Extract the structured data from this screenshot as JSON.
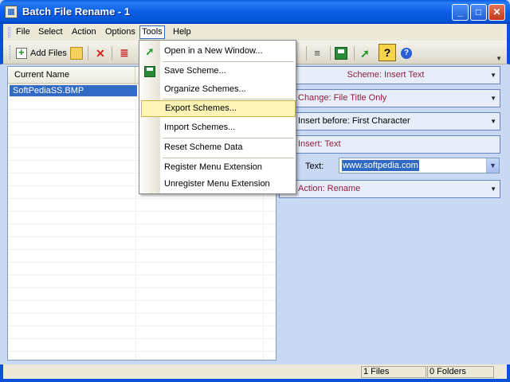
{
  "window": {
    "title": "Batch File Rename - 1",
    "controls": {
      "minimize": "_",
      "maximize": "□",
      "close": "✕"
    }
  },
  "menubar": {
    "items": [
      {
        "label": "File",
        "active": false
      },
      {
        "label": "Select",
        "active": false
      },
      {
        "label": "Action",
        "active": false
      },
      {
        "label": "Options",
        "active": false
      },
      {
        "label": "Tools",
        "active": true
      },
      {
        "label": "Help",
        "active": false
      }
    ]
  },
  "toolbar": {
    "add_files_label": "Add Files",
    "icons": [
      "add-files-icon",
      "add-folder-icon",
      "delete-icon",
      "red-list-icon",
      "align-icon",
      "save-icon",
      "up-icon",
      "help-icon",
      "info-icon"
    ]
  },
  "filelist": {
    "columns": [
      "Current Name"
    ],
    "rows": [
      {
        "name": "SoftPediaSS.BMP",
        "selected": true
      }
    ]
  },
  "tools_menu": {
    "items": [
      {
        "label": "Open in a New Window...",
        "icon": "open-window-icon",
        "highlighted": false
      },
      {
        "label": "Save Scheme...",
        "icon": "save-icon",
        "highlighted": false
      },
      {
        "label": "Organize Schemes...",
        "icon": "",
        "highlighted": false
      },
      {
        "label": "Export Schemes...",
        "icon": "",
        "highlighted": true
      },
      {
        "label": "Import Schemes...",
        "icon": "",
        "highlighted": false
      },
      {
        "label": "Reset Scheme Data",
        "icon": "",
        "highlighted": false
      },
      {
        "label": "Register Menu Extension",
        "icon": "",
        "highlighted": false
      },
      {
        "label": "Unregister Menu Extension",
        "icon": "",
        "highlighted": false
      }
    ]
  },
  "scheme_panel": {
    "scheme": "Scheme: Insert Text",
    "change": "Change: File Title Only",
    "insert_before": "Insert before: First Character",
    "insert": "Insert: Text",
    "text_label": "Text:",
    "text_value": "www.softpedia.com",
    "action": "Action: Rename"
  },
  "statusbar": {
    "files": "1 Files",
    "folders": "0 Folders"
  },
  "colors": {
    "title_blue": "#0a5be0",
    "panel_text": "#8c1d3e",
    "selection": "#316ac5",
    "menu_highlight": "#fff4b8"
  }
}
